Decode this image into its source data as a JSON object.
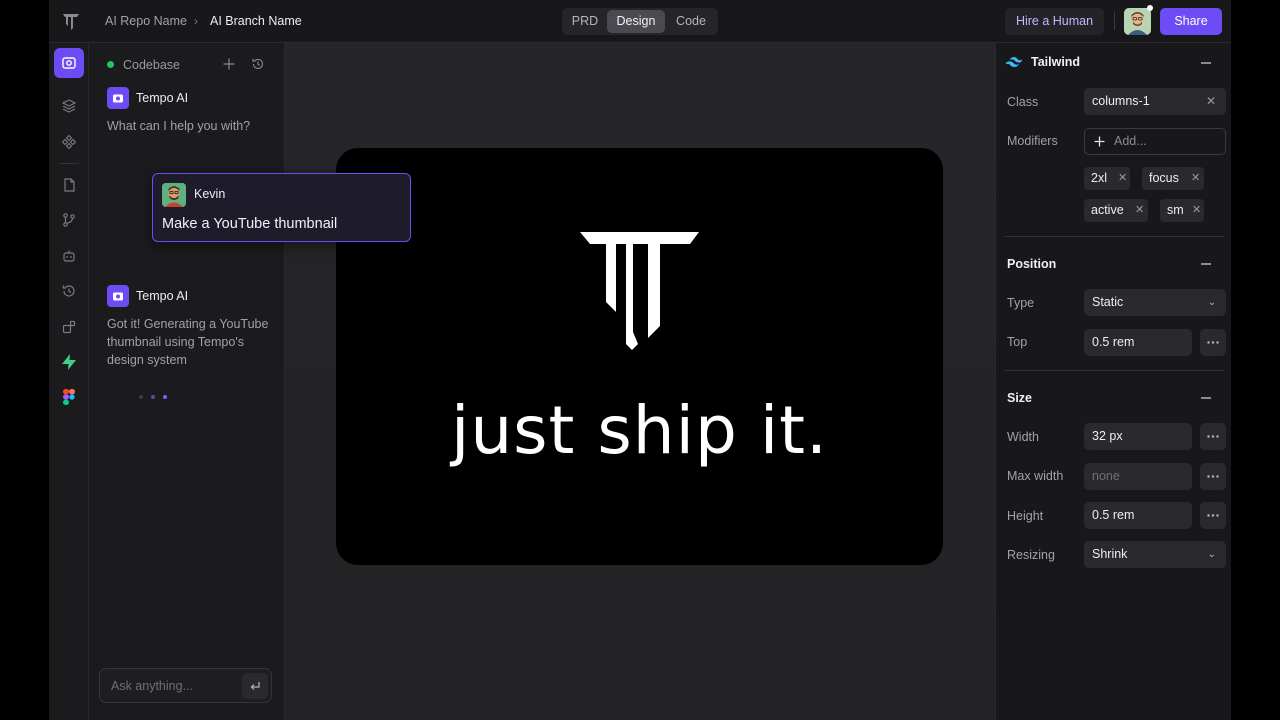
{
  "topbar": {
    "repo": "AI Repo Name",
    "separator": "›",
    "branch": "AI Branch Name",
    "tabs": [
      "PRD",
      "Design",
      "Code"
    ],
    "active_tab": "Design",
    "hire_label": "Hire a Human",
    "share_label": "Share"
  },
  "rail": {
    "items": [
      "chat-icon",
      "layers-icon",
      "components-icon",
      "file-icon",
      "branch-icon",
      "robot-icon",
      "history-icon",
      "add-block-icon",
      "bolt-icon",
      "figma-icon"
    ],
    "active": "chat-icon"
  },
  "chat": {
    "header_label": "Codebase",
    "messages": [
      {
        "author": "Tempo AI",
        "text": "What can I help you with?"
      },
      {
        "author": "Kevin",
        "text": "Make a YouTube thumbnail"
      },
      {
        "author": "Tempo AI",
        "text": "Got it! Generating a YouTube thumbnail using Tempo's design system"
      }
    ],
    "input_placeholder": "Ask anything..."
  },
  "canvas": {
    "thumbnail_text": "just ship it."
  },
  "inspector": {
    "tailwind": {
      "title": "Tailwind",
      "class_label": "Class",
      "class_value": "columns-1",
      "modifiers_label": "Modifiers",
      "add_placeholder": "Add...",
      "modifiers": [
        "2xl",
        "focus",
        "active",
        "sm"
      ]
    },
    "position": {
      "title": "Position",
      "type_label": "Type",
      "type_value": "Static",
      "top_label": "Top",
      "top_value": "0.5 rem"
    },
    "size": {
      "title": "Size",
      "width_label": "Width",
      "width_value": "32 px",
      "max_width_label": "Max width",
      "max_width_value": "none",
      "height_label": "Height",
      "height_value": "0.5 rem",
      "resizing_label": "Resizing",
      "resizing_value": "Shrink"
    }
  },
  "colors": {
    "accent": "#6d4cf5",
    "status_green": "#22c55e",
    "hire_text": "#c4b5fd"
  }
}
